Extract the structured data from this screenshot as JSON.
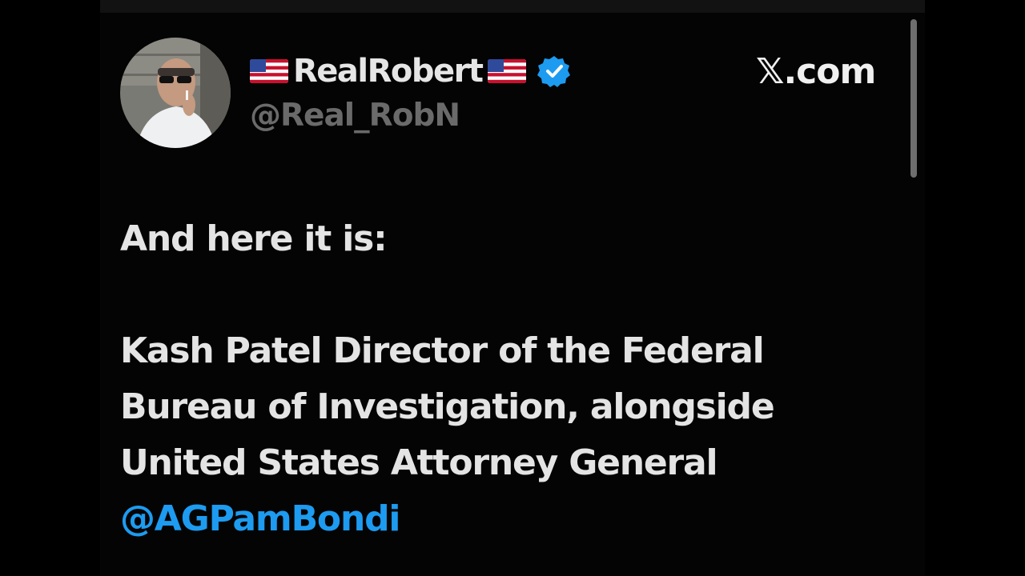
{
  "post": {
    "author": {
      "display_name": "RealRobert",
      "handle": "@Real_RobN",
      "flag_icon": "us-flag-icon",
      "verified_icon": "verified-badge-icon"
    },
    "site_label": "𝕏.com",
    "body_lines": [
      "And here it is:",
      "Kash Patel Director of the Federal",
      "Bureau of Investigation, alongside",
      "United States Attorney General"
    ],
    "mention": "@AGPamBondi"
  },
  "colors": {
    "background": "#000000",
    "text": "#e4e4e4",
    "handle": "#6a6a6a",
    "mention": "#1d9bf0",
    "verified": "#1d9bf0"
  }
}
